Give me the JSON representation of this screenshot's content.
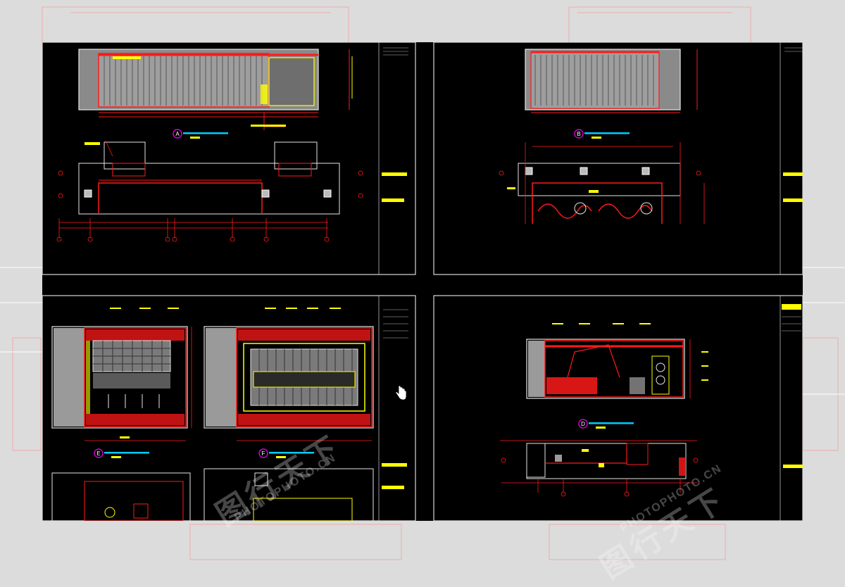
{
  "colors": {
    "background": "#000000",
    "accent_red": "#ff1a1a",
    "accent_yellow": "#ffff00",
    "line_white": "#e6e6e6",
    "fill_gray": "#9a9a9a",
    "label_cyan": "#00ccff",
    "tag_magenta": "#ff00ff"
  },
  "sheets": [
    {
      "id": "top-left",
      "elevation_tags": [
        "A"
      ]
    },
    {
      "id": "top-right",
      "elevation_tags": [
        "B"
      ]
    },
    {
      "id": "bottom-left",
      "elevation_tags": [
        "E",
        "F"
      ]
    },
    {
      "id": "bottom-right",
      "elevation_tags": [
        "D"
      ]
    }
  ],
  "watermark": {
    "cn": "图行天下",
    "en": "PHOTOPHOTO.CN"
  },
  "icons": [
    "hand-cursor-icon"
  ]
}
